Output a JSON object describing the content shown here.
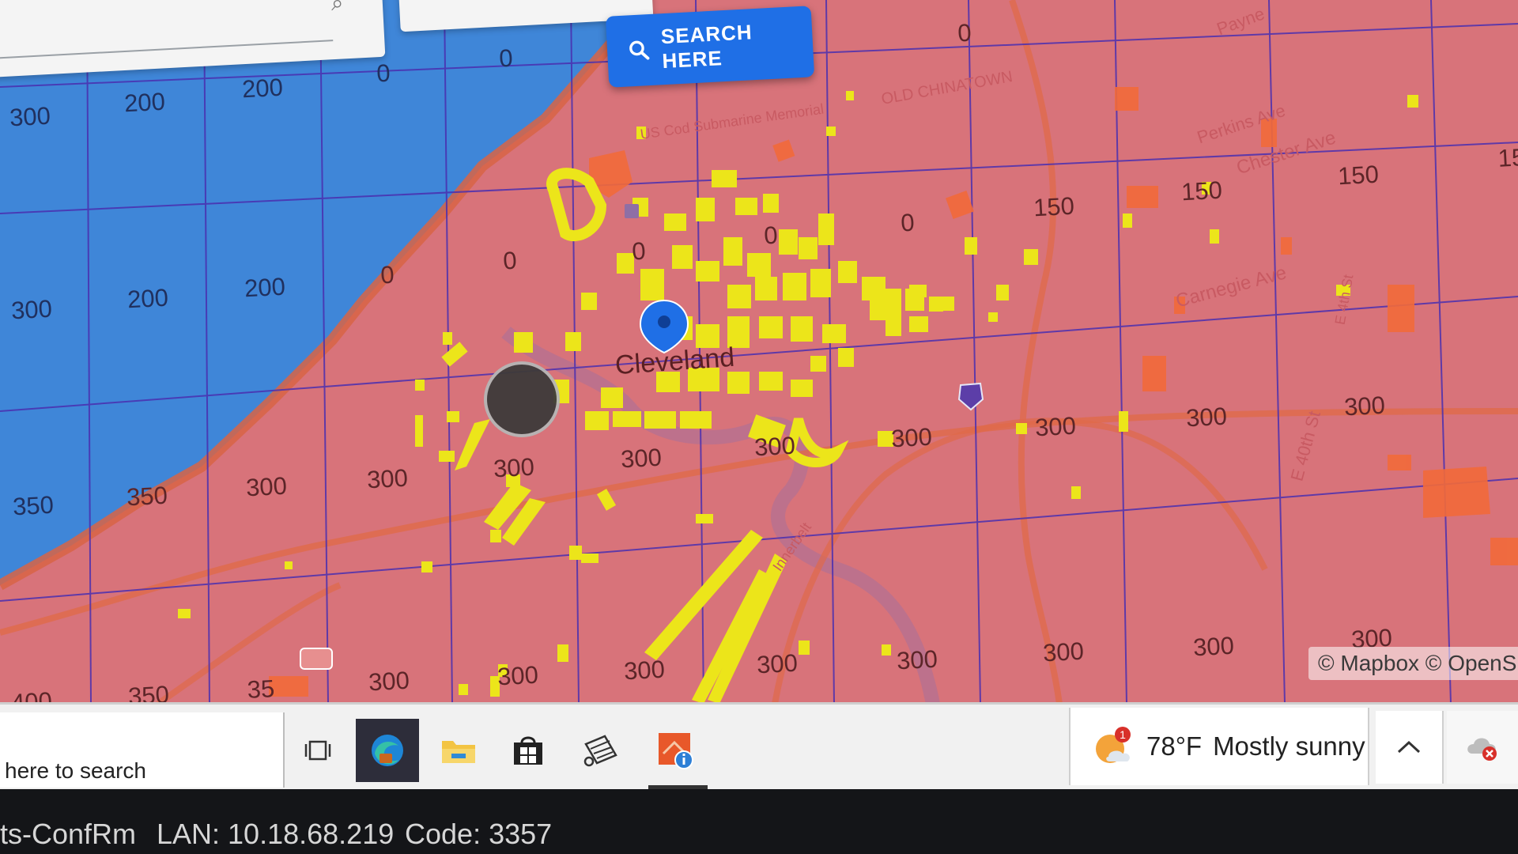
{
  "map": {
    "search_button_label": "SEARCH HERE",
    "city_label": "Cleveland",
    "attribution": "© Mapbox © OpenS",
    "grid_labels": [
      {
        "text": "300",
        "zone": "water"
      },
      {
        "text": "200",
        "zone": "water"
      },
      {
        "text": "200",
        "zone": "water"
      },
      {
        "text": "0",
        "zone": "water"
      },
      {
        "text": "0",
        "zone": "water"
      },
      {
        "text": "300",
        "zone": "water"
      },
      {
        "text": "200",
        "zone": "water"
      },
      {
        "text": "200",
        "zone": "water"
      },
      {
        "text": "350",
        "zone": "water"
      },
      {
        "text": "0",
        "zone": "land"
      },
      {
        "text": "0",
        "zone": "land"
      },
      {
        "text": "0",
        "zone": "land"
      },
      {
        "text": "0",
        "zone": "land"
      },
      {
        "text": "0",
        "zone": "land"
      },
      {
        "text": "0",
        "zone": "land"
      },
      {
        "text": "150",
        "zone": "land"
      },
      {
        "text": "150",
        "zone": "land"
      },
      {
        "text": "150",
        "zone": "land"
      },
      {
        "text": "15",
        "zone": "land"
      },
      {
        "text": "350",
        "zone": "land"
      },
      {
        "text": "300",
        "zone": "land"
      },
      {
        "text": "300",
        "zone": "land"
      },
      {
        "text": "300",
        "zone": "land"
      },
      {
        "text": "300",
        "zone": "land"
      },
      {
        "text": "300",
        "zone": "land"
      },
      {
        "text": "300",
        "zone": "land"
      },
      {
        "text": "300",
        "zone": "land"
      },
      {
        "text": "300",
        "zone": "land"
      },
      {
        "text": "300",
        "zone": "land"
      },
      {
        "text": "400",
        "zone": "land"
      },
      {
        "text": "350",
        "zone": "land"
      },
      {
        "text": "35",
        "zone": "land"
      },
      {
        "text": "300",
        "zone": "land"
      },
      {
        "text": "300",
        "zone": "land"
      },
      {
        "text": "300",
        "zone": "land"
      },
      {
        "text": "300",
        "zone": "land"
      },
      {
        "text": "300",
        "zone": "land"
      },
      {
        "text": "300",
        "zone": "land"
      },
      {
        "text": "300",
        "zone": "land"
      },
      {
        "text": "300",
        "zone": "land"
      }
    ],
    "street_labels": [
      "Payne",
      "Perkins Ave",
      "Chester Ave",
      "Carnegie Ave",
      "E 40th St",
      "E 4th St",
      "OLD CHINATOWN",
      "US Cod Submarine Memorial",
      "Innerbelt"
    ],
    "colors": {
      "water": "#3f86d8",
      "land": "#d8737a",
      "grid": "#4a2fb0",
      "buildings": "#ece51a",
      "parcels": "#f26a3a",
      "marker": "#1f6fe6"
    },
    "icons": [
      "search-icon",
      "location-pin-icon"
    ]
  },
  "taskbar": {
    "search_text": "here to search",
    "apps": [
      "task-view-icon",
      "edge-browser-icon",
      "file-explorer-icon",
      "microsoft-store-icon",
      "snipping-tool-icon",
      "map-app-icon"
    ],
    "weather": {
      "temperature": "78°F",
      "condition": "Mostly sunny",
      "badge": "1"
    },
    "tray": [
      "chevron-up-icon",
      "cloud-error-icon"
    ]
  },
  "bezel": {
    "room": "ts-ConfRm",
    "lan": "LAN: 10.18.68.219",
    "code": "Code: 3357"
  }
}
